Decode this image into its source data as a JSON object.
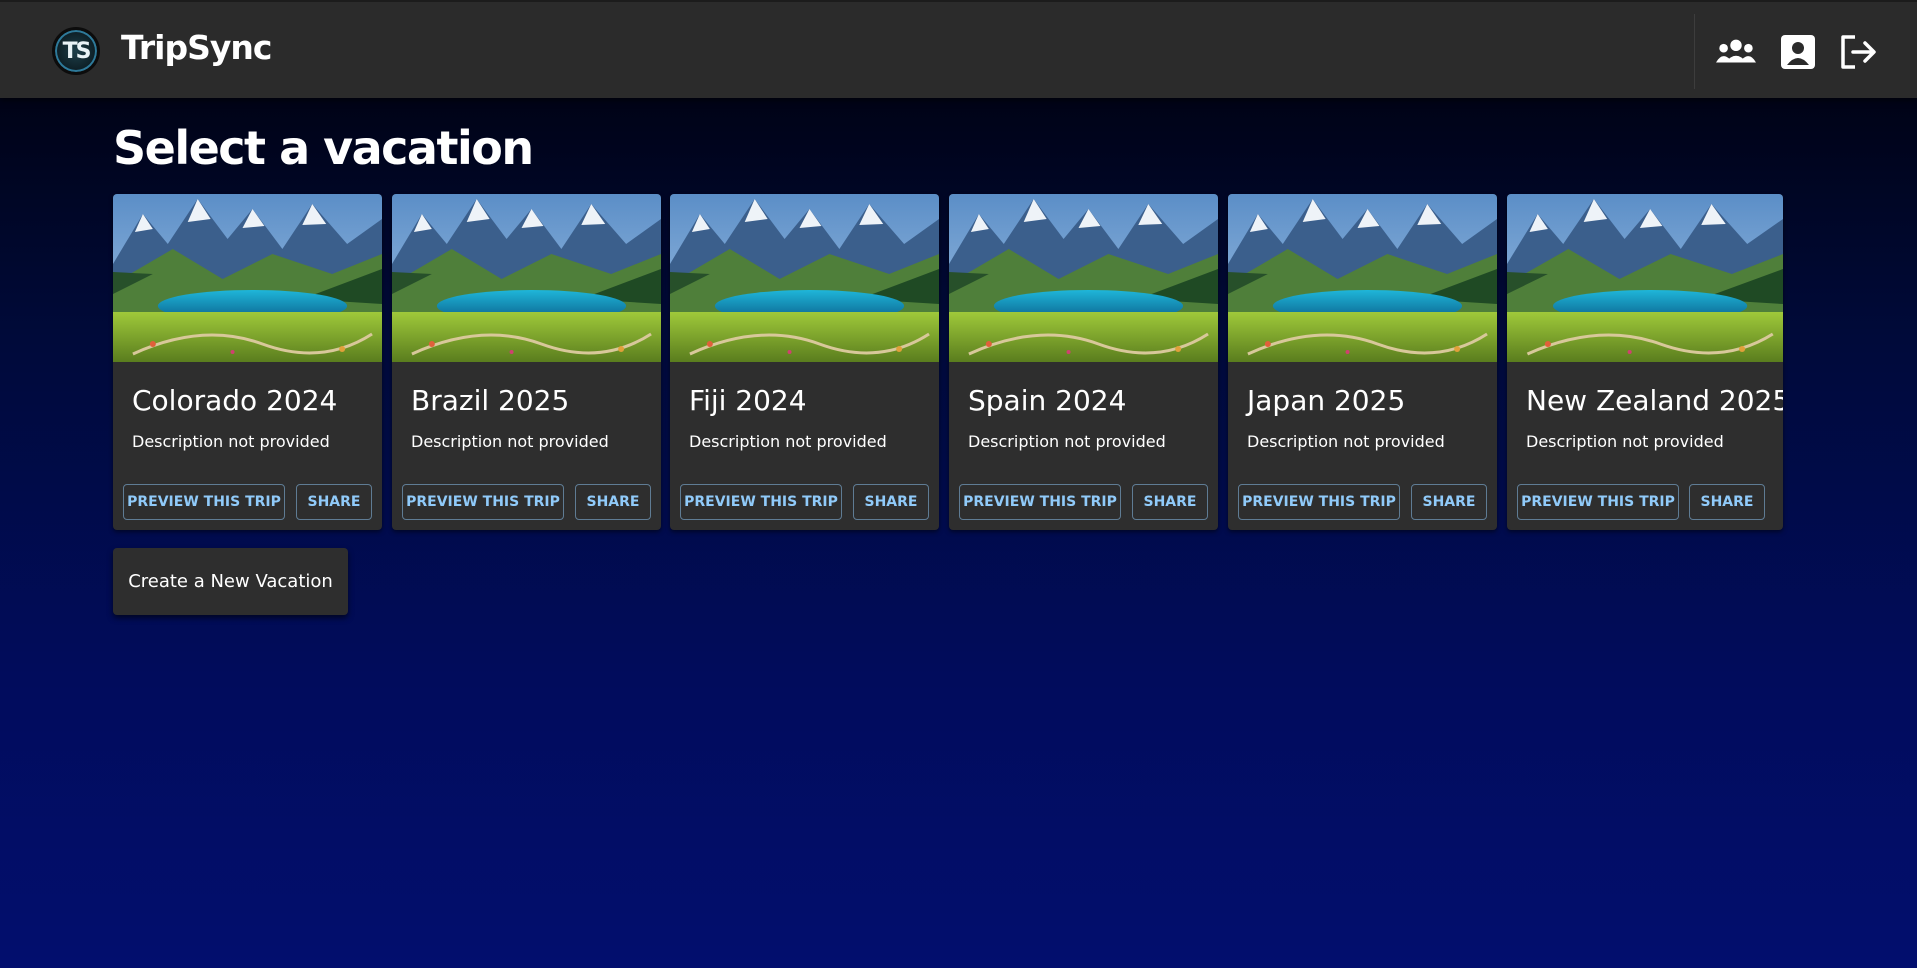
{
  "app": {
    "logo_text": "TS",
    "title": "TripSync"
  },
  "nav": {
    "icons": [
      "group-icon",
      "account-box-icon",
      "logout-icon"
    ]
  },
  "page": {
    "heading": "Select a vacation"
  },
  "vacations": [
    {
      "title": "Colorado 2024",
      "description": "Description not provided",
      "preview_label": "PREVIEW THIS TRIP",
      "share_label": "SHARE"
    },
    {
      "title": "Brazil 2025",
      "description": "Description not provided",
      "preview_label": "PREVIEW THIS TRIP",
      "share_label": "SHARE"
    },
    {
      "title": "Fiji 2024",
      "description": "Description not provided",
      "preview_label": "PREVIEW THIS TRIP",
      "share_label": "SHARE"
    },
    {
      "title": "Spain 2024",
      "description": "Description not provided",
      "preview_label": "PREVIEW THIS TRIP",
      "share_label": "SHARE"
    },
    {
      "title": "Japan 2025",
      "description": "Description not provided",
      "preview_label": "PREVIEW THIS TRIP",
      "share_label": "SHARE"
    },
    {
      "title": "New Zealand 2025",
      "description": "Description not provided",
      "preview_label": "PREVIEW THIS TRIP",
      "share_label": "SHARE"
    }
  ],
  "create_button": {
    "label": "Create a New Vacation"
  },
  "colors": {
    "topbar": "#2b2b2b",
    "card": "#2e2e2e",
    "accent": "#90caf9"
  }
}
